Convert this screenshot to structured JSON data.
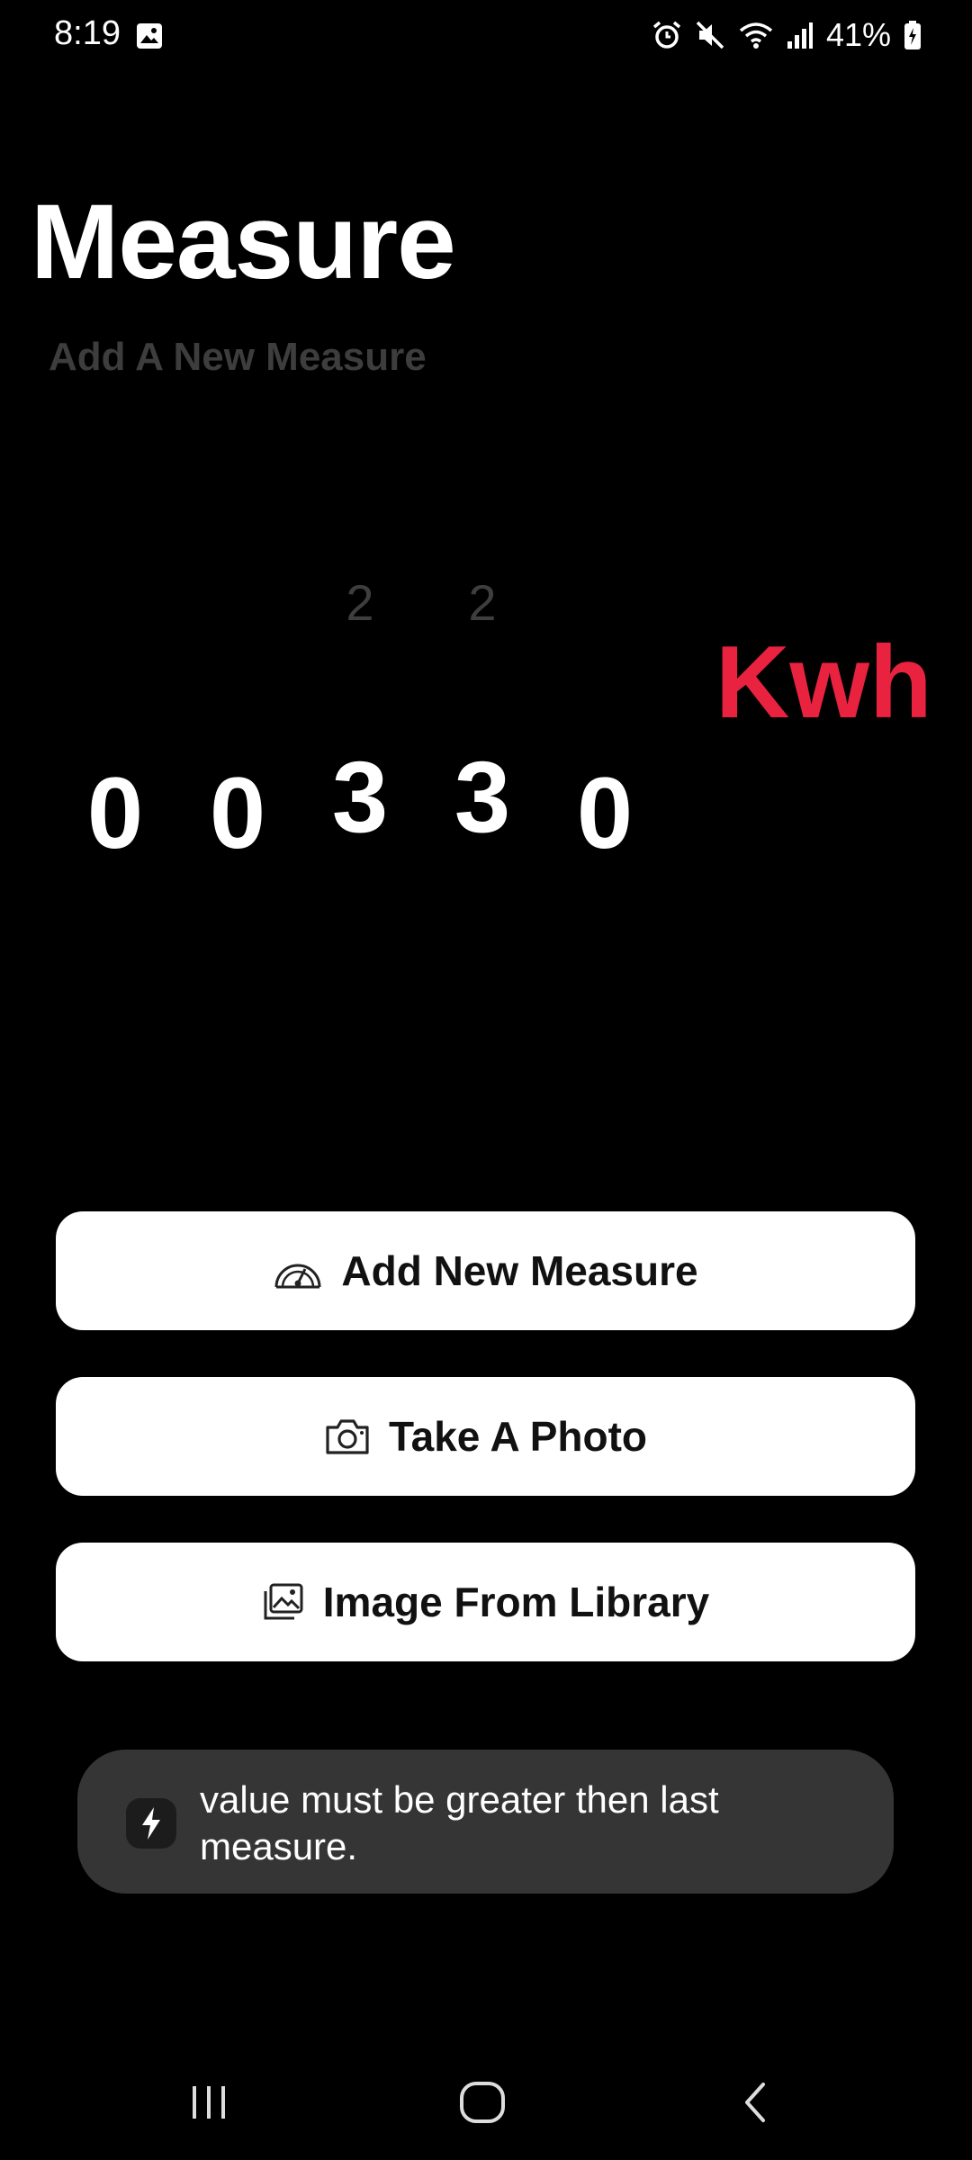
{
  "status_bar": {
    "time": "8:19",
    "battery": "41%",
    "icons": [
      "gallery-icon",
      "alarm-icon",
      "mute-icon",
      "wifi-icon",
      "signal-icon",
      "battery-icon"
    ]
  },
  "header": {
    "title": "Measure",
    "subtitle": "Add A New Measure"
  },
  "reading": {
    "above": [
      "",
      "",
      "2",
      "2",
      ""
    ],
    "digits": [
      "0",
      "0",
      "3",
      "3",
      "0"
    ],
    "unit": "Kwh",
    "unit_color": "#e8223f"
  },
  "actions": [
    {
      "label": "Add New Measure",
      "icon": "gauge-icon"
    },
    {
      "label": "Take A Photo",
      "icon": "camera-icon"
    },
    {
      "label": "Image From Library",
      "icon": "gallery-icon"
    }
  ],
  "toast": {
    "icon": "lightning-icon",
    "message": "value must be greater then last measure."
  },
  "nav": {
    "buttons": [
      "recents-icon",
      "home-icon",
      "back-icon"
    ]
  }
}
